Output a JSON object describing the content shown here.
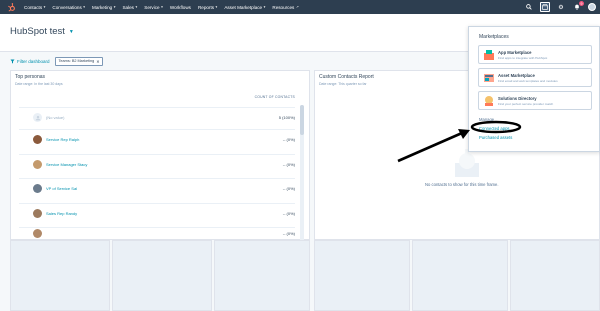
{
  "nav": {
    "items": [
      {
        "label": "Contacts"
      },
      {
        "label": "Conversations"
      },
      {
        "label": "Marketing"
      },
      {
        "label": "Sales"
      },
      {
        "label": "Service"
      },
      {
        "label": "Workflows"
      },
      {
        "label": "Reports"
      },
      {
        "label": "Asset Marketplace"
      },
      {
        "label": "Resources"
      }
    ],
    "notification_count": "9"
  },
  "dashboard": {
    "title": "HubSpot test",
    "filter_label": "Filter dashboard",
    "chip_label": "Teams: B2 Marketing"
  },
  "personas_card": {
    "title": "Top personas",
    "subtitle": "Date range: In the last 30 days",
    "column_header": "COUNT OF CONTACTS",
    "rows": [
      {
        "name": "(No value)",
        "value": "5 (100%)"
      },
      {
        "name": "Service Rep Ralph",
        "value": "-- (0%)"
      },
      {
        "name": "Service Manager Stacy",
        "value": "-- (0%)"
      },
      {
        "name": "VP of Service Sal",
        "value": "-- (0%)"
      },
      {
        "name": "Sales Rep Randy",
        "value": "-- (0%)"
      }
    ]
  },
  "custom_card": {
    "title": "Custom Contacts Report",
    "subtitle": "Date range: This quarter so far",
    "empty_message": "No contacts to show for this time frame."
  },
  "marketplaces": {
    "title": "Marketplaces",
    "items": [
      {
        "title": "App Marketplace",
        "desc": "Find apps to integrate with HubSpot"
      },
      {
        "title": "Asset Marketplace",
        "desc": "Find email and web templates and modules"
      },
      {
        "title": "Solutions Directory",
        "desc": "Find your perfect service provider match"
      }
    ],
    "manage_label": "Manage",
    "links": [
      "Connected apps",
      "Purchased assets"
    ]
  }
}
